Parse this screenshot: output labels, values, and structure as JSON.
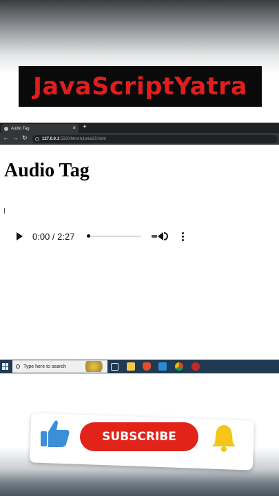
{
  "brand": {
    "title": "JavaScriptYatra",
    "color": "#e11d1d"
  },
  "browser": {
    "tab_title": "Audio Tag",
    "tab_close": "×",
    "new_tab": "+",
    "nav": {
      "back": "←",
      "forward": "→",
      "reload": "↻"
    },
    "url_host": "127.0.0.1",
    "url_rest": ":5500/html-tutorial20.html"
  },
  "page": {
    "heading": "Audio Tag",
    "audio": {
      "time": "0:00 / 2:27",
      "position_fraction": 0.0
    }
  },
  "taskbar": {
    "search_placeholder": "Type here to search",
    "icons": [
      "windows-start",
      "task-view",
      "file-explorer",
      "brave-browser",
      "vscode",
      "chrome",
      "app"
    ]
  },
  "promo": {
    "subscribe_label": "SUBSCRIBE",
    "colors": {
      "subscribe": "#e2231a",
      "thumb": "#3b8ed8",
      "bell": "#f5c518"
    }
  }
}
